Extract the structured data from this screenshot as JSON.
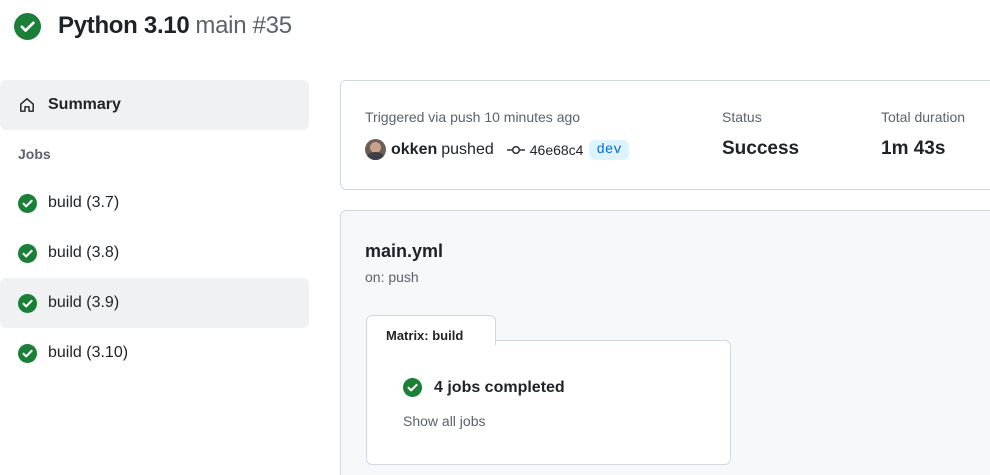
{
  "header": {
    "title": "Python 3.10",
    "subtitle": "main #35",
    "status_icon": "check-circle-fill-icon",
    "success_color": "#1a7f37"
  },
  "sidebar": {
    "summary_label": "Summary",
    "summary_icon": "home-icon",
    "jobs_heading": "Jobs",
    "jobs": [
      {
        "label": "build (3.7)",
        "status": "success"
      },
      {
        "label": "build (3.8)",
        "status": "success"
      },
      {
        "label": "build (3.9)",
        "status": "success",
        "selected": true
      },
      {
        "label": "build (3.10)",
        "status": "success"
      }
    ]
  },
  "summary": {
    "triggered_label": "Triggered via push 10 minutes ago",
    "actor": "okken",
    "action": "pushed",
    "commit": "46e68c4",
    "branch": "dev",
    "status_label": "Status",
    "status_value": "Success",
    "duration_label": "Total duration",
    "duration_value": "1m 43s"
  },
  "workflow": {
    "name": "main.yml",
    "trigger": "on: push",
    "matrix_tab": "Matrix: build",
    "jobs_completed": "4 jobs completed",
    "show_all": "Show all jobs"
  },
  "colors": {
    "accent_link": "#0969da",
    "branch_bg": "#ddf4ff",
    "muted_text": "#59636e"
  }
}
